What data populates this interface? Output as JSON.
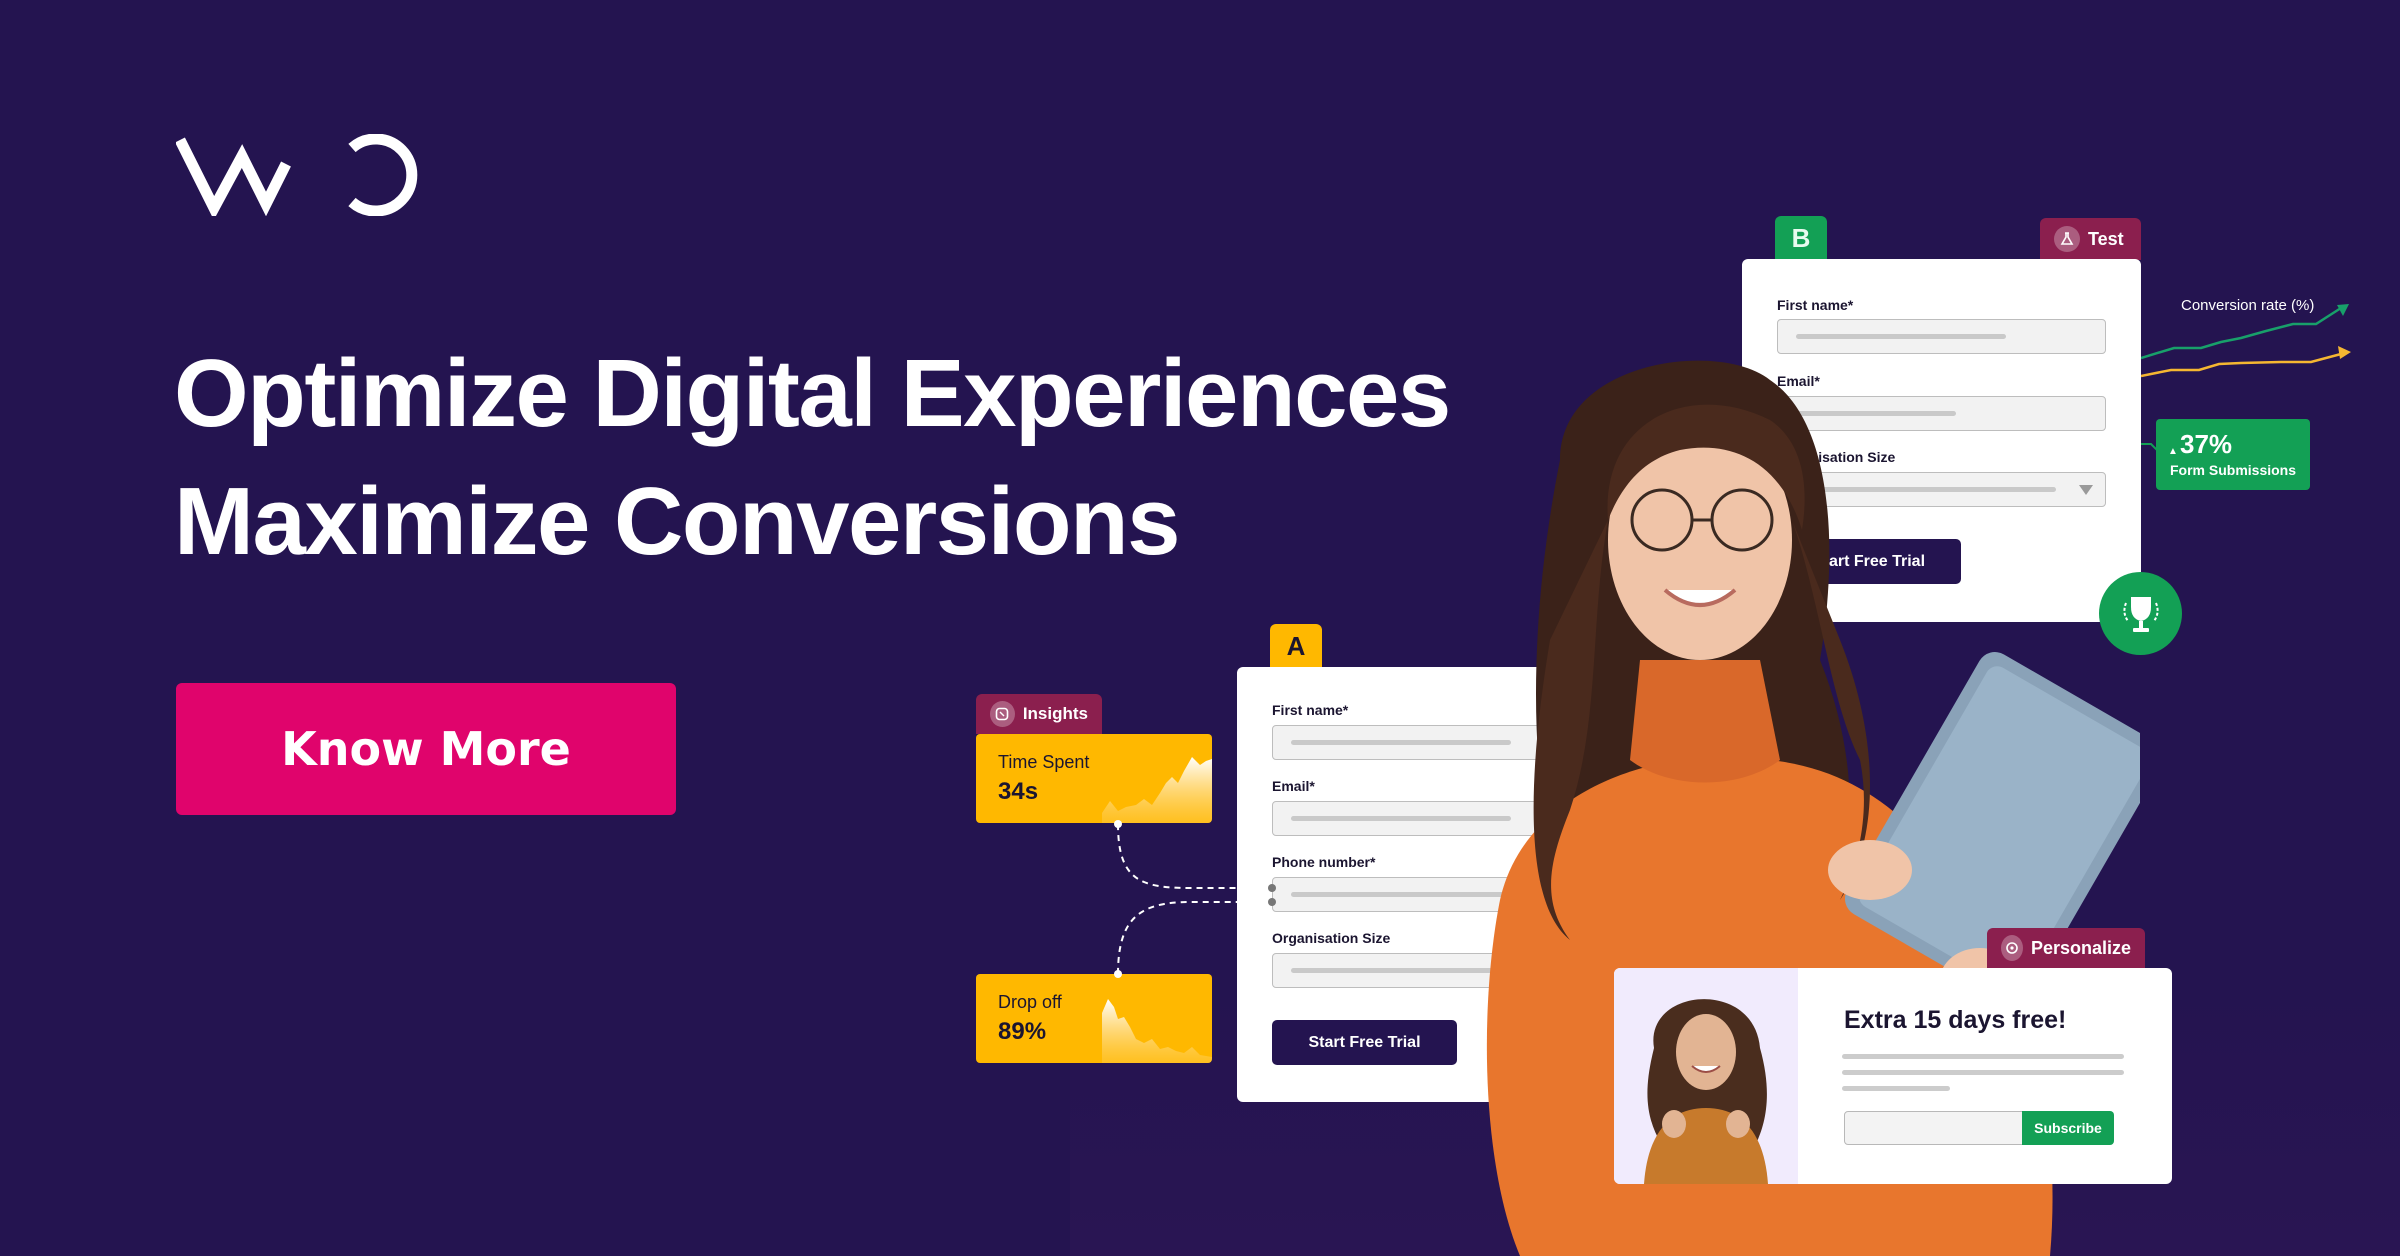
{
  "brand": {
    "logo_text": "VWO",
    "colors": {
      "background": "#241450",
      "cta": "#e0046c",
      "green": "#13a055",
      "yellow": "#ffb800",
      "tag": "#8b1f4e",
      "orange_line": "#f5b731"
    }
  },
  "hero": {
    "headline_line1": "Optimize Digital Experiences",
    "headline_line2": "Maximize Conversions",
    "cta_label": "Know More"
  },
  "variant_b": {
    "tab_label": "B",
    "tag_label": "Test",
    "tag_icon": "flask-icon",
    "fields": [
      {
        "label": "First name*"
      },
      {
        "label": "Email*"
      },
      {
        "label": "Organisation Size",
        "visible_label": "tion Size",
        "type": "select"
      }
    ],
    "button_label": "Start Free Trial",
    "button_visible_label": "rt Free Trial",
    "badge_icon": "trophy-icon"
  },
  "variant_a": {
    "tab_label": "A",
    "fields": [
      {
        "label": "First name*"
      },
      {
        "label": "Email*"
      },
      {
        "label": "Phone number*"
      },
      {
        "label": "Organisation Size"
      }
    ],
    "button_label": "Start Free Trial"
  },
  "insights": {
    "tag_label": "Insights",
    "tag_icon": "insights-icon",
    "cards": [
      {
        "label": "Time Spent",
        "value": "34s",
        "trend": "rising"
      },
      {
        "label": "Drop off",
        "value": "89%",
        "trend": "falling"
      }
    ]
  },
  "conversion": {
    "label": "Conversion rate (%)",
    "stat_value": "37%",
    "stat_arrow": "▲",
    "stat_label": "Form Submissions"
  },
  "personalize": {
    "tag_label": "Personalize",
    "tag_icon": "target-icon",
    "title": "Extra 15 days free!",
    "input_value": "",
    "subscribe_label": "Subscribe"
  }
}
